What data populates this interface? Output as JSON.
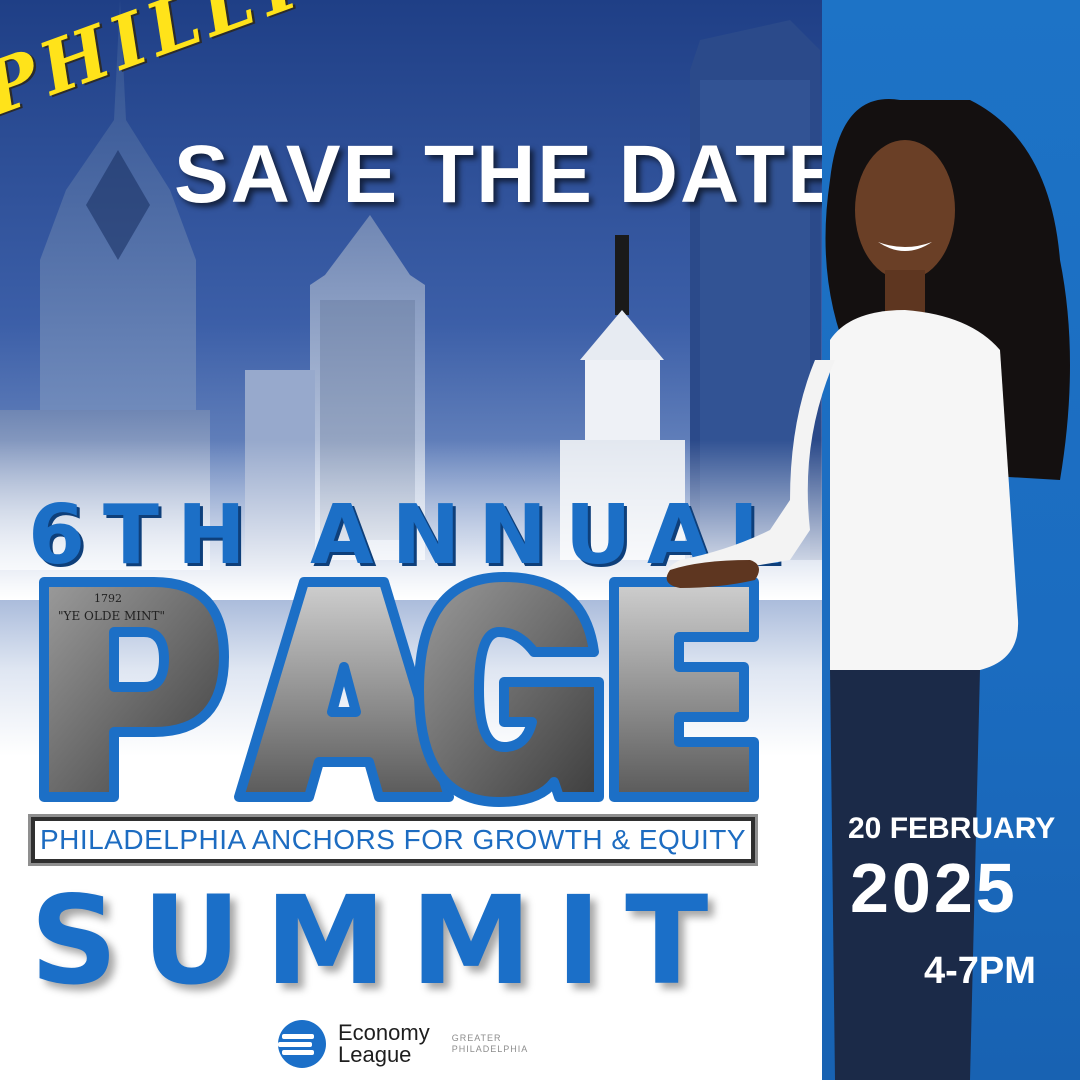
{
  "header": {
    "script_word": "PHILLY",
    "headline": "SAVE THE DATE"
  },
  "event": {
    "edition": "6TH ANNUAL",
    "acronym": "PAGE",
    "full_name": "PHILADELPHIA ANCHORS FOR GROWTH & EQUITY",
    "type": "SUMMIT",
    "date_line": "20 FEBRUARY",
    "year": "2025",
    "time": "4-7PM"
  },
  "photo_labels": {
    "mint_year": "1792",
    "mint_sign": "\"YE OLDE MINT\""
  },
  "organizer": {
    "name_line1": "Economy",
    "name_line2": "League",
    "sub_line1": "GREATER",
    "sub_line2": "PHILADELPHIA"
  },
  "colors": {
    "brand_blue": "#1c6fc6",
    "accent_yellow": "#ffe31a",
    "panel_blue": "#1b6cc0"
  },
  "icons": {
    "logo": "economy-league-logo-icon"
  }
}
